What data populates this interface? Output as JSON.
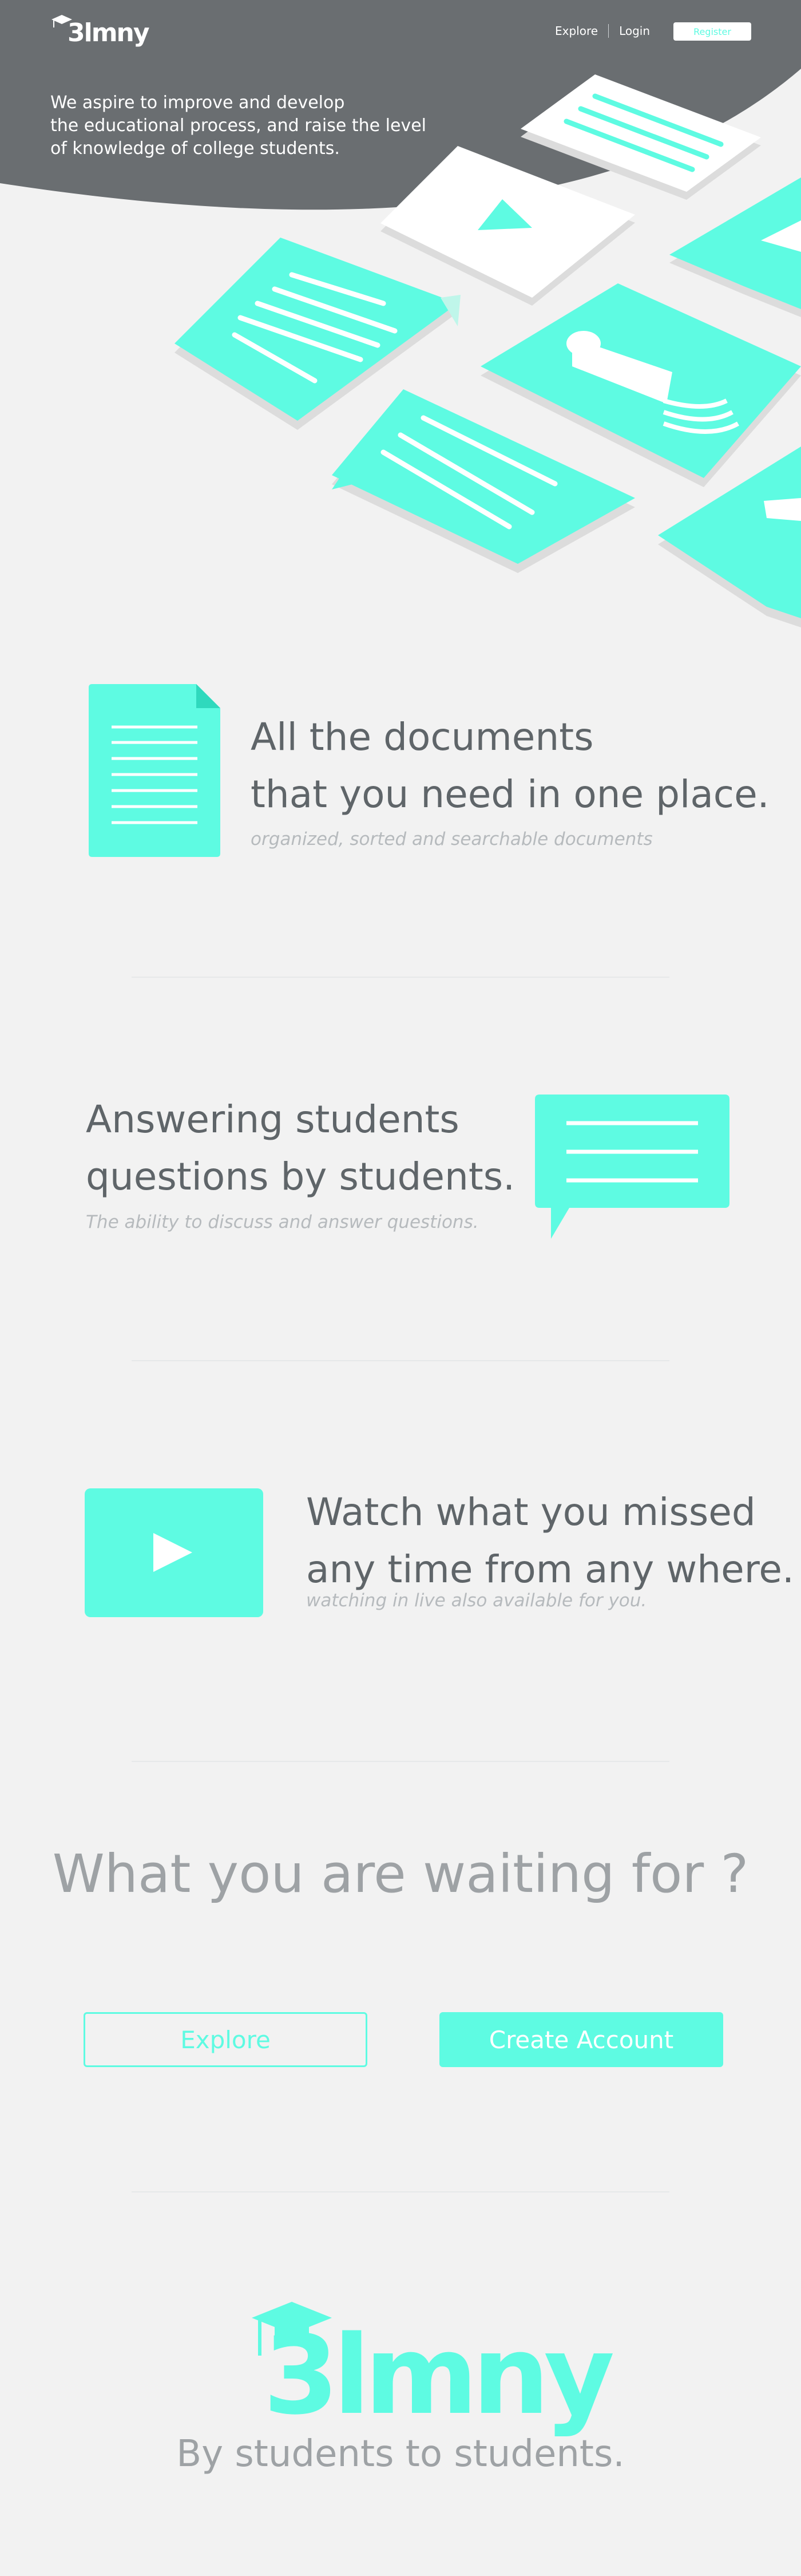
{
  "brand": {
    "name": "3lmny"
  },
  "nav": {
    "explore_label": "Explore",
    "login_label": "Login",
    "register_label": "Register"
  },
  "hero": {
    "tagline_lines": [
      "We aspire to improve and develop",
      "the educational process, and raise the level",
      "of knowledge of college students."
    ]
  },
  "features": [
    {
      "title_lines": [
        "All the documents",
        "that you need in one place."
      ],
      "subtitle": "organized, sorted and searchable documents",
      "icon": "document-icon"
    },
    {
      "title_lines": [
        "Answering students",
        "questions by students."
      ],
      "subtitle": "The ability to discuss and answer questions.",
      "icon": "chat-bubble-icon"
    },
    {
      "title_lines": [
        "Watch what you missed",
        "any time from any where."
      ],
      "subtitle": "watching in live also available for you.",
      "icon": "play-icon"
    }
  ],
  "cta": {
    "title": "What you are waiting for ?",
    "explore_label": "Explore",
    "create_label": "Create Account"
  },
  "footer": {
    "tagline": "By students to students."
  },
  "colors": {
    "accent": "#5efbe2",
    "dark": "#6a6e71",
    "background": "#f2f2f2",
    "text": "#5f6569",
    "muted": "#9ea2a5"
  }
}
